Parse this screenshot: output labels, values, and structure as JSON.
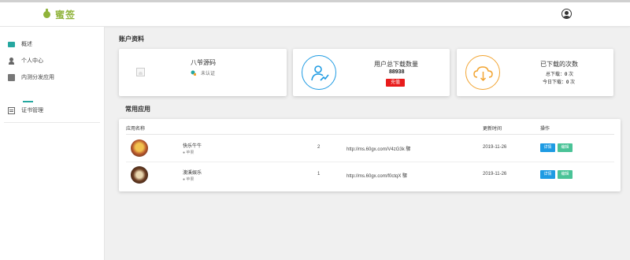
{
  "header": {
    "logo_text": "蜜签"
  },
  "sidebar": {
    "items": [
      {
        "label": "概述",
        "icon": "monitor-icon"
      },
      {
        "label": "个人中心",
        "icon": "user-icon"
      },
      {
        "label": "内测分发应用",
        "icon": "box-icon"
      },
      {
        "label": "证书管理",
        "icon": "certificate-icon"
      }
    ]
  },
  "account": {
    "section_title": "账户资料",
    "profile": {
      "name": "八爷源码",
      "status": "未认证"
    },
    "downloads": {
      "title": "用户总下载数量",
      "value": "88938",
      "recharge_label": "充值"
    },
    "used": {
      "title": "已下载的次数",
      "total_label": "总下载：",
      "total_value": "0",
      "total_unit": "次",
      "today_label": "今日下载：",
      "today_value": "0",
      "today_unit": "次"
    }
  },
  "apps": {
    "section_title": "常用应用",
    "columns": {
      "name": "应用名称",
      "updated": "更新时间",
      "actions": "操作"
    },
    "rows": [
      {
        "name": "快乐牛牛",
        "platform": "苹果",
        "count": "2",
        "url": "http://ms.60gx.com/V4zG3k",
        "url_suffix": "驟",
        "date": "2019-11-26",
        "detail_label": "详情",
        "edit_label": "编辑"
      },
      {
        "name": "澳溪娱乐",
        "platform": "苹果",
        "count": "1",
        "url": "http://ms.60gx.com/f0ctqX",
        "url_suffix": "驟",
        "date": "2019-11-26",
        "detail_label": "详情",
        "edit_label": "编辑"
      }
    ]
  },
  "colors": {
    "accent": "#8fb33a",
    "teal": "#25a7a0",
    "blue": "#1e9be3",
    "green": "#4ac397",
    "red": "#e81b1b",
    "orange": "#f2a431"
  }
}
